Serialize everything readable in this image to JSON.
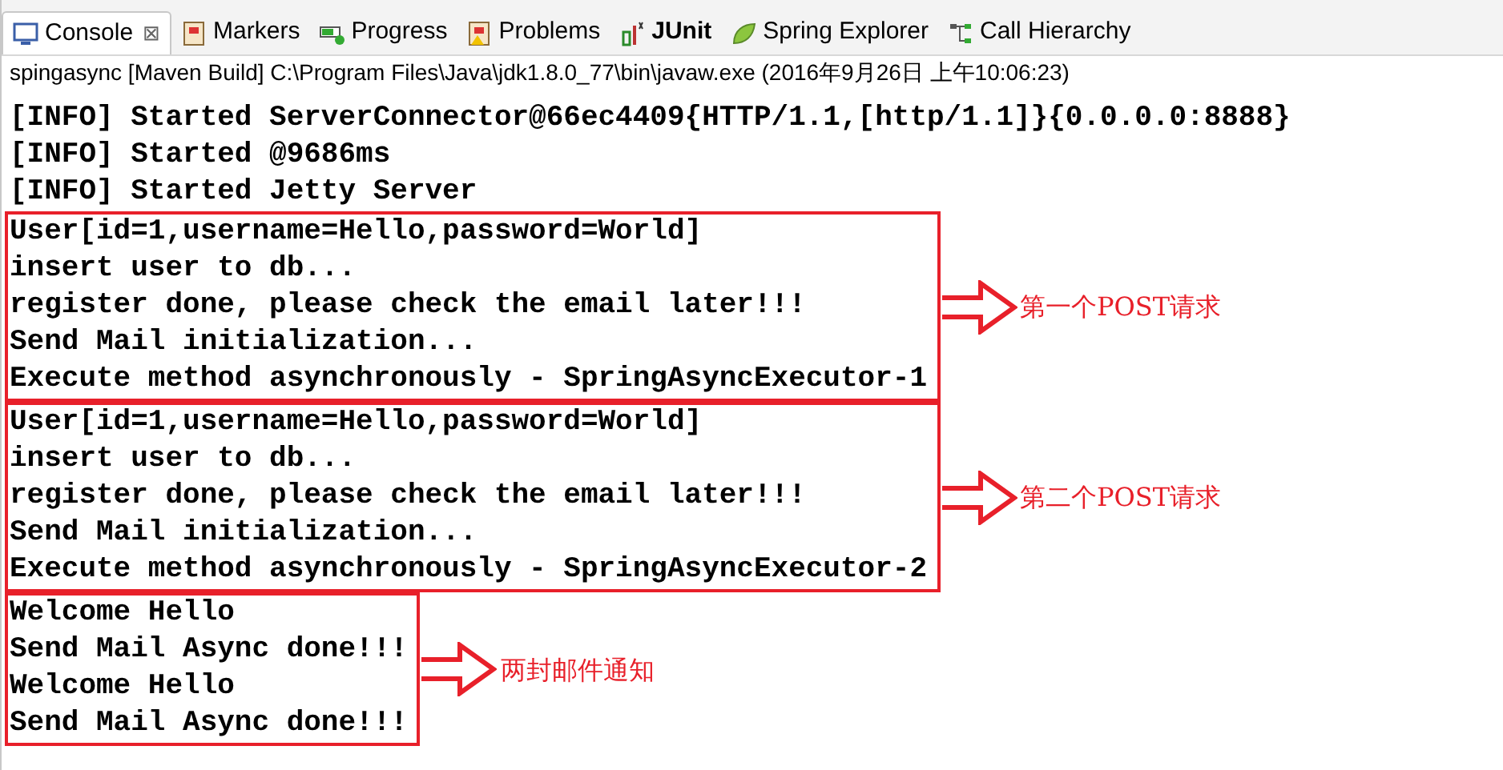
{
  "tabs": [
    {
      "label": "Console",
      "selected": true
    },
    {
      "label": "Markers",
      "selected": false
    },
    {
      "label": "Progress",
      "selected": false
    },
    {
      "label": "Problems",
      "selected": false
    },
    {
      "label": "JUnit",
      "selected": false
    },
    {
      "label": "Spring Explorer",
      "selected": false
    },
    {
      "label": "Call Hierarchy",
      "selected": false
    }
  ],
  "close_glyph": "⊠",
  "process_title": "spingasync [Maven Build] C:\\Program Files\\Java\\jdk1.8.0_77\\bin\\javaw.exe (2016年9月26日 上午10:06:23)",
  "console_lines": [
    "[INFO] Started ServerConnector@66ec4409{HTTP/1.1,[http/1.1]}{0.0.0.0:8888}",
    "[INFO] Started @9686ms",
    "[INFO] Started Jetty Server"
  ],
  "annotated_groups": [
    {
      "lines": [
        "User[id=1,username=Hello,password=World]",
        "insert user to db...",
        "register done, please check the email later!!!",
        "Send Mail initialization...",
        "Execute method asynchronously - SpringAsyncExecutor-1"
      ],
      "annotation": "第一个POST请求"
    },
    {
      "lines": [
        "User[id=1,username=Hello,password=World]",
        "insert user to db...",
        "register done, please check the email later!!!",
        "Send Mail initialization...",
        "Execute method asynchronously - SpringAsyncExecutor-2"
      ],
      "annotation": "第二个POST请求"
    },
    {
      "lines": [
        "Welcome Hello",
        "Send Mail Async done!!!",
        "Welcome Hello",
        "Send Mail Async done!!!"
      ],
      "annotation": "两封邮件通知"
    }
  ]
}
